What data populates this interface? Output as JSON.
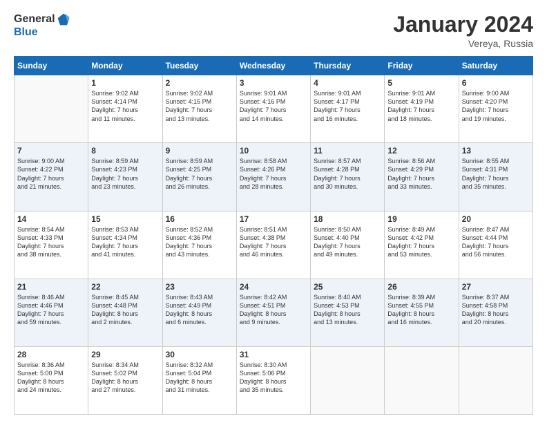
{
  "header": {
    "logo_general": "General",
    "logo_blue": "Blue",
    "month_title": "January 2024",
    "subtitle": "Vereya, Russia"
  },
  "days_of_week": [
    "Sunday",
    "Monday",
    "Tuesday",
    "Wednesday",
    "Thursday",
    "Friday",
    "Saturday"
  ],
  "weeks": [
    {
      "alt": false,
      "days": [
        {
          "num": "",
          "info": ""
        },
        {
          "num": "1",
          "info": "Sunrise: 9:02 AM\nSunset: 4:14 PM\nDaylight: 7 hours\nand 11 minutes."
        },
        {
          "num": "2",
          "info": "Sunrise: 9:02 AM\nSunset: 4:15 PM\nDaylight: 7 hours\nand 13 minutes."
        },
        {
          "num": "3",
          "info": "Sunrise: 9:01 AM\nSunset: 4:16 PM\nDaylight: 7 hours\nand 14 minutes."
        },
        {
          "num": "4",
          "info": "Sunrise: 9:01 AM\nSunset: 4:17 PM\nDaylight: 7 hours\nand 16 minutes."
        },
        {
          "num": "5",
          "info": "Sunrise: 9:01 AM\nSunset: 4:19 PM\nDaylight: 7 hours\nand 18 minutes."
        },
        {
          "num": "6",
          "info": "Sunrise: 9:00 AM\nSunset: 4:20 PM\nDaylight: 7 hours\nand 19 minutes."
        }
      ]
    },
    {
      "alt": true,
      "days": [
        {
          "num": "7",
          "info": "Sunrise: 9:00 AM\nSunset: 4:22 PM\nDaylight: 7 hours\nand 21 minutes."
        },
        {
          "num": "8",
          "info": "Sunrise: 8:59 AM\nSunset: 4:23 PM\nDaylight: 7 hours\nand 23 minutes."
        },
        {
          "num": "9",
          "info": "Sunrise: 8:59 AM\nSunset: 4:25 PM\nDaylight: 7 hours\nand 26 minutes."
        },
        {
          "num": "10",
          "info": "Sunrise: 8:58 AM\nSunset: 4:26 PM\nDaylight: 7 hours\nand 28 minutes."
        },
        {
          "num": "11",
          "info": "Sunrise: 8:57 AM\nSunset: 4:28 PM\nDaylight: 7 hours\nand 30 minutes."
        },
        {
          "num": "12",
          "info": "Sunrise: 8:56 AM\nSunset: 4:29 PM\nDaylight: 7 hours\nand 33 minutes."
        },
        {
          "num": "13",
          "info": "Sunrise: 8:55 AM\nSunset: 4:31 PM\nDaylight: 7 hours\nand 35 minutes."
        }
      ]
    },
    {
      "alt": false,
      "days": [
        {
          "num": "14",
          "info": "Sunrise: 8:54 AM\nSunset: 4:33 PM\nDaylight: 7 hours\nand 38 minutes."
        },
        {
          "num": "15",
          "info": "Sunrise: 8:53 AM\nSunset: 4:34 PM\nDaylight: 7 hours\nand 41 minutes."
        },
        {
          "num": "16",
          "info": "Sunrise: 8:52 AM\nSunset: 4:36 PM\nDaylight: 7 hours\nand 43 minutes."
        },
        {
          "num": "17",
          "info": "Sunrise: 8:51 AM\nSunset: 4:38 PM\nDaylight: 7 hours\nand 46 minutes."
        },
        {
          "num": "18",
          "info": "Sunrise: 8:50 AM\nSunset: 4:40 PM\nDaylight: 7 hours\nand 49 minutes."
        },
        {
          "num": "19",
          "info": "Sunrise: 8:49 AM\nSunset: 4:42 PM\nDaylight: 7 hours\nand 53 minutes."
        },
        {
          "num": "20",
          "info": "Sunrise: 8:47 AM\nSunset: 4:44 PM\nDaylight: 7 hours\nand 56 minutes."
        }
      ]
    },
    {
      "alt": true,
      "days": [
        {
          "num": "21",
          "info": "Sunrise: 8:46 AM\nSunset: 4:46 PM\nDaylight: 7 hours\nand 59 minutes."
        },
        {
          "num": "22",
          "info": "Sunrise: 8:45 AM\nSunset: 4:48 PM\nDaylight: 8 hours\nand 2 minutes."
        },
        {
          "num": "23",
          "info": "Sunrise: 8:43 AM\nSunset: 4:49 PM\nDaylight: 8 hours\nand 6 minutes."
        },
        {
          "num": "24",
          "info": "Sunrise: 8:42 AM\nSunset: 4:51 PM\nDaylight: 8 hours\nand 9 minutes."
        },
        {
          "num": "25",
          "info": "Sunrise: 8:40 AM\nSunset: 4:53 PM\nDaylight: 8 hours\nand 13 minutes."
        },
        {
          "num": "26",
          "info": "Sunrise: 8:39 AM\nSunset: 4:55 PM\nDaylight: 8 hours\nand 16 minutes."
        },
        {
          "num": "27",
          "info": "Sunrise: 8:37 AM\nSunset: 4:58 PM\nDaylight: 8 hours\nand 20 minutes."
        }
      ]
    },
    {
      "alt": false,
      "days": [
        {
          "num": "28",
          "info": "Sunrise: 8:36 AM\nSunset: 5:00 PM\nDaylight: 8 hours\nand 24 minutes."
        },
        {
          "num": "29",
          "info": "Sunrise: 8:34 AM\nSunset: 5:02 PM\nDaylight: 8 hours\nand 27 minutes."
        },
        {
          "num": "30",
          "info": "Sunrise: 8:32 AM\nSunset: 5:04 PM\nDaylight: 8 hours\nand 31 minutes."
        },
        {
          "num": "31",
          "info": "Sunrise: 8:30 AM\nSunset: 5:06 PM\nDaylight: 8 hours\nand 35 minutes."
        },
        {
          "num": "",
          "info": ""
        },
        {
          "num": "",
          "info": ""
        },
        {
          "num": "",
          "info": ""
        }
      ]
    }
  ]
}
